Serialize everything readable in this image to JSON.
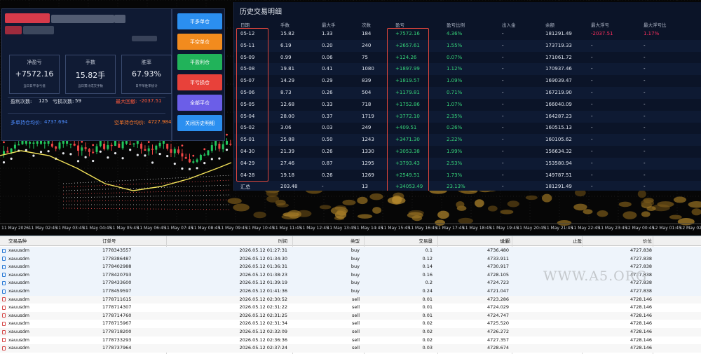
{
  "chart": {
    "time_ticks": [
      "11 May 2026",
      "11 May 02:45",
      "11 May 03:45",
      "11 May 04:45",
      "11 May 05:45",
      "11 May 06:45",
      "11 May 07:45",
      "11 May 08:45",
      "11 May 09:45",
      "11 May 10:45",
      "11 May 11:45",
      "11 May 12:45",
      "11 May 13:45",
      "11 May 14:45",
      "11 May 15:45",
      "11 May 16:45",
      "11 May 17:45",
      "11 May 18:45",
      "11 May 19:45",
      "11 May 20:45",
      "11 May 21:45",
      "11 May 22:45",
      "11 May 23:45",
      "12 May 00:45",
      "12 May 01:45",
      "12 May 02:45"
    ],
    "colors": {
      "bull": "#22c55e",
      "bear": "#ef4444",
      "ma": "#f3e35a",
      "marker": "#e5e7eb"
    }
  },
  "account_panel": {
    "stats": [
      {
        "label": "净盈亏",
        "value": "+7572.16",
        "sub": "当日日平净亏值"
      },
      {
        "label": "手数",
        "value": "15.82手",
        "sub": "当日累计成交手数"
      },
      {
        "label": "胜率",
        "value": "67.93%",
        "sub": "日平单胜率统计"
      }
    ],
    "win_count_label": "盈利次数:",
    "win_count": "125",
    "loss_count_label": "亏损次数:",
    "loss_count": "59",
    "max_drawdown_label": "最大回撤:",
    "max_drawdown": "-2037.51",
    "long_avg_label": "多单持仓均价:",
    "long_avg": "4737.694",
    "short_avg_label": "空单持仓均价:",
    "short_avg": "4727.984"
  },
  "buttons": [
    {
      "label": "平多单仓",
      "color": "#2b8ff0"
    },
    {
      "label": "平空单仓",
      "color": "#f28b1e"
    },
    {
      "label": "平盈利仓",
      "color": "#21b35a"
    },
    {
      "label": "平亏损仓",
      "color": "#e8413a"
    },
    {
      "label": "全部平仓",
      "color": "#6b5ee8"
    },
    {
      "label": "关闭历史明细",
      "color": "#2b8ff0"
    }
  ],
  "history": {
    "title": "历史交易明细",
    "columns": [
      "日期",
      "手数",
      "最大手",
      "次数",
      "盈亏",
      "盈亏比例",
      "出入金",
      "余额",
      "最大浮亏",
      "最大浮亏比"
    ],
    "rows": [
      {
        "date": "05-12",
        "lots": "15.82",
        "max_lot": "1.33",
        "count": "184",
        "pnl": "+7572.16",
        "ratio": "4.36%",
        "flow": "-",
        "balance": "181291.49",
        "max_float": "-2037.51",
        "max_float_ratio": "1.17%"
      },
      {
        "date": "05-11",
        "lots": "6.19",
        "max_lot": "0.20",
        "count": "240",
        "pnl": "+2657.61",
        "ratio": "1.55%",
        "flow": "-",
        "balance": "173719.33",
        "max_float": "-",
        "max_float_ratio": "-"
      },
      {
        "date": "05-09",
        "lots": "0.99",
        "max_lot": "0.06",
        "count": "75",
        "pnl": "+124.26",
        "ratio": "0.07%",
        "flow": "-",
        "balance": "171061.72",
        "max_float": "-",
        "max_float_ratio": "-"
      },
      {
        "date": "05-08",
        "lots": "19.81",
        "max_lot": "0.41",
        "count": "1080",
        "pnl": "+1897.99",
        "ratio": "1.12%",
        "flow": "-",
        "balance": "170937.46",
        "max_float": "-",
        "max_float_ratio": "-"
      },
      {
        "date": "05-07",
        "lots": "14.29",
        "max_lot": "0.29",
        "count": "839",
        "pnl": "+1819.57",
        "ratio": "1.09%",
        "flow": "-",
        "balance": "169039.47",
        "max_float": "-",
        "max_float_ratio": "-"
      },
      {
        "date": "05-06",
        "lots": "8.73",
        "max_lot": "0.26",
        "count": "504",
        "pnl": "+1179.81",
        "ratio": "0.71%",
        "flow": "-",
        "balance": "167219.90",
        "max_float": "-",
        "max_float_ratio": "-"
      },
      {
        "date": "05-05",
        "lots": "12.68",
        "max_lot": "0.33",
        "count": "718",
        "pnl": "+1752.86",
        "ratio": "1.07%",
        "flow": "-",
        "balance": "166040.09",
        "max_float": "-",
        "max_float_ratio": "-"
      },
      {
        "date": "05-04",
        "lots": "28.00",
        "max_lot": "0.37",
        "count": "1719",
        "pnl": "+3772.10",
        "ratio": "2.35%",
        "flow": "-",
        "balance": "164287.23",
        "max_float": "-",
        "max_float_ratio": "-"
      },
      {
        "date": "05-02",
        "lots": "3.06",
        "max_lot": "0.03",
        "count": "249",
        "pnl": "+409.51",
        "ratio": "0.26%",
        "flow": "-",
        "balance": "160515.13",
        "max_float": "-",
        "max_float_ratio": "-"
      },
      {
        "date": "05-01",
        "lots": "25.88",
        "max_lot": "0.50",
        "count": "1243",
        "pnl": "+3471.30",
        "ratio": "2.22%",
        "flow": "-",
        "balance": "160105.62",
        "max_float": "-",
        "max_float_ratio": "-"
      },
      {
        "date": "04-30",
        "lots": "21.39",
        "max_lot": "0.26",
        "count": "1330",
        "pnl": "+3053.38",
        "ratio": "1.99%",
        "flow": "-",
        "balance": "156634.32",
        "max_float": "-",
        "max_float_ratio": "-"
      },
      {
        "date": "04-29",
        "lots": "27.46",
        "max_lot": "0.87",
        "count": "1295",
        "pnl": "+3793.43",
        "ratio": "2.53%",
        "flow": "-",
        "balance": "153580.94",
        "max_float": "-",
        "max_float_ratio": "-"
      },
      {
        "date": "04-28",
        "lots": "19.18",
        "max_lot": "0.26",
        "count": "1269",
        "pnl": "+2549.51",
        "ratio": "1.73%",
        "flow": "-",
        "balance": "149787.51",
        "max_float": "-",
        "max_float_ratio": "-"
      }
    ],
    "total": {
      "date": "汇总",
      "lots": "203.48",
      "max_lot": "-",
      "count": "13",
      "pnl": "+34053.49",
      "ratio": "23.13%",
      "flow": "-",
      "balance": "181291.49",
      "max_float": "-",
      "max_float_ratio": "-"
    }
  },
  "orders": {
    "columns": [
      "交易品种",
      "订单号",
      "时间",
      "类型",
      "交易量",
      "价位",
      "止损",
      "止盈",
      "价位"
    ],
    "rows": [
      {
        "symbol": "xauusdm",
        "ticket": "1778343557",
        "time": "2026.05.12 01:27:31",
        "type": "buy",
        "volume": "0.1",
        "price": "4736.480",
        "sl": "",
        "tp": "",
        "current": "4727.838"
      },
      {
        "symbol": "xauusdm",
        "ticket": "1778386487",
        "time": "2026.05.12 01:34:30",
        "type": "buy",
        "volume": "0.12",
        "price": "4733.911",
        "sl": "",
        "tp": "",
        "current": "4727.838"
      },
      {
        "symbol": "xauusdm",
        "ticket": "1778402988",
        "time": "2026.05.12 01:36:31",
        "type": "buy",
        "volume": "0.14",
        "price": "4730.917",
        "sl": "",
        "tp": "",
        "current": "4727.838"
      },
      {
        "symbol": "xauusdm",
        "ticket": "1778420793",
        "time": "2026.05.12 01:38:23",
        "type": "buy",
        "volume": "0.16",
        "price": "4728.105",
        "sl": "",
        "tp": "",
        "current": "4727.838"
      },
      {
        "symbol": "xauusdm",
        "ticket": "1778433600",
        "time": "2026.05.12 01:39:19",
        "type": "buy",
        "volume": "0.2",
        "price": "4724.723",
        "sl": "",
        "tp": "",
        "current": "4727.838"
      },
      {
        "symbol": "xauusdm",
        "ticket": "1778459597",
        "time": "2026.05.12 01:41:36",
        "type": "buy",
        "volume": "0.24",
        "price": "4721.047",
        "sl": "",
        "tp": "",
        "current": "4727.838"
      },
      {
        "symbol": "xauusdm",
        "ticket": "1778711615",
        "time": "2026.05.12 02:30:52",
        "type": "sell",
        "volume": "0.01",
        "price": "4723.286",
        "sl": "",
        "tp": "",
        "current": "4728.146"
      },
      {
        "symbol": "xauusdm",
        "ticket": "1778714307",
        "time": "2026.05.12 02:31:22",
        "type": "sell",
        "volume": "0.01",
        "price": "4724.029",
        "sl": "",
        "tp": "",
        "current": "4728.146"
      },
      {
        "symbol": "xauusdm",
        "ticket": "1778714760",
        "time": "2026.05.12 02:31:25",
        "type": "sell",
        "volume": "0.01",
        "price": "4724.747",
        "sl": "",
        "tp": "",
        "current": "4728.146"
      },
      {
        "symbol": "xauusdm",
        "ticket": "1778715967",
        "time": "2026.05.12 02:31:34",
        "type": "sell",
        "volume": "0.02",
        "price": "4725.520",
        "sl": "",
        "tp": "",
        "current": "4728.146"
      },
      {
        "symbol": "xauusdm",
        "ticket": "1778718200",
        "time": "2026.05.12 02:32:09",
        "type": "sell",
        "volume": "0.02",
        "price": "4726.272",
        "sl": "",
        "tp": "",
        "current": "4728.146"
      },
      {
        "symbol": "xauusdm",
        "ticket": "1778733293",
        "time": "2026.05.12 02:36:36",
        "type": "sell",
        "volume": "0.02",
        "price": "4727.357",
        "sl": "",
        "tp": "",
        "current": "4728.146"
      },
      {
        "symbol": "xauusdm",
        "ticket": "1778737964",
        "time": "2026.05.12 02:37:24",
        "type": "sell",
        "volume": "0.03",
        "price": "4728.674",
        "sl": "",
        "tp": "",
        "current": "4728.146"
      }
    ]
  },
  "watermark": "WWW.A5.ORG"
}
